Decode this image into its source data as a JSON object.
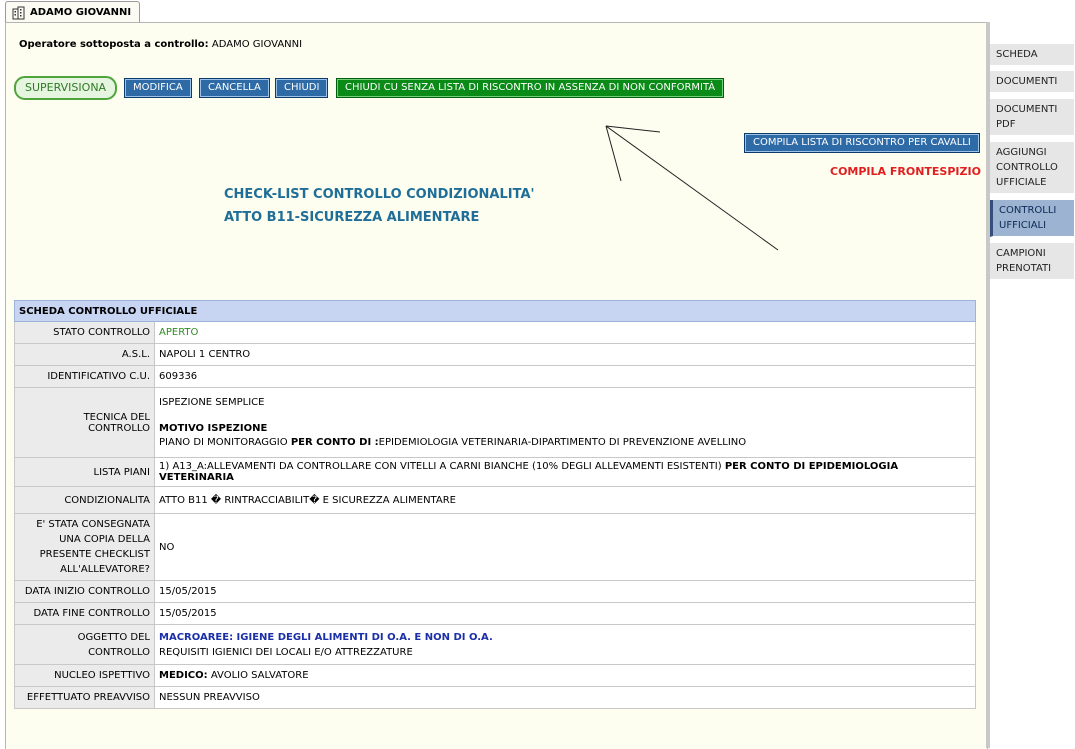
{
  "tab": {
    "icon": "building-icon",
    "label": "ADAMO GIOVANNI"
  },
  "operator": {
    "label": "Operatore sottoposta a controllo:",
    "name": "ADAMO GIOVANNI"
  },
  "buttons": {
    "supervisiona": "SUPERVISIONA",
    "modifica": "MODIFICA",
    "cancella": "CANCELLA",
    "chiudi": "CHIUDI",
    "chiudi_cu": "CHIUDI CU SENZA LISTA DI RISCONTRO IN ASSENZA DI NON CONFORMITÀ",
    "compila_lista": "COMPILA LISTA DI RISCONTRO PER CAVALLI"
  },
  "frontespizio": "COMPILA FRONTESPIZIO",
  "checklist_title": {
    "line1": "CHECK-LIST CONTROLLO CONDIZIONALITA'",
    "line2": "ATTO B11-SICUREZZA ALIMENTARE"
  },
  "table": {
    "header": "SCHEDA CONTROLLO UFFICIALE",
    "stato_label": "STATO CONTROLLO",
    "stato_value": "APERTO",
    "asl_label": "A.S.L.",
    "asl_value": "NAPOLI 1 CENTRO",
    "id_label": "IDENTIFICATIVO C.U.",
    "id_value": "609336",
    "tecnica_label": "TECNICA DEL CONTROLLO",
    "tecnica_value": "ISPEZIONE SEMPLICE",
    "motivo_label": "MOTIVO ISPEZIONE",
    "piano_prefix": "PIANO DI MONITORAGGIO",
    "piano_bold": "PER CONTO DI :",
    "piano_suffix": "EPIDEMIOLOGIA VETERINARIA-DIPARTIMENTO DI PREVENZIONE AVELLINO",
    "lista_label": "LISTA PIANI",
    "lista_value": "1) A13_A:ALLEVAMENTI DA CONTROLLARE CON VITELLI A CARNI BIANCHE (10% DEGLI ALLEVAMENTI ESISTENTI)",
    "lista_bold": "PER CONTO DI EPIDEMIOLOGIA VETERINARIA",
    "cond_label": "CONDIZIONALITA",
    "cond_value": "ATTO B11 � RINTRACCIABILIT� E SICUREZZA ALIMENTARE",
    "consegna_label": "E' STATA CONSEGNATA UNA COPIA DELLA PRESENTE CHECKLIST ALL'ALLEVATORE?",
    "consegna_value": "NO",
    "inizio_label": "DATA INIZIO CONTROLLO",
    "inizio_value": "15/05/2015",
    "fine_label": "DATA FINE CONTROLLO",
    "fine_value": "15/05/2015",
    "oggetto_label": "OGGETTO DEL CONTROLLO",
    "oggetto_macro": "MACROAREE: IGIENE DEGLI ALIMENTI DI O.A. E NON DI O.A.",
    "oggetto_req": "REQUISITI IGIENICI DEI LOCALI E/O ATTREZZATURE",
    "nucleo_label": "NUCLEO ISPETTIVO",
    "nucleo_bold": "MEDICO:",
    "nucleo_value": "AVOLIO SALVATORE",
    "preavviso_label": "EFFETTUATO PREAVVISO",
    "preavviso_value": "NESSUN PREAVVISO"
  },
  "side_menu": [
    {
      "label": "SCHEDA",
      "active": false
    },
    {
      "label": "DOCUMENTI",
      "active": false
    },
    {
      "label": "DOCUMENTI PDF",
      "active": false
    },
    {
      "label": "AGGIUNGI CONTROLLO UFFICIALE",
      "active": false
    },
    {
      "label": "CONTROLLI UFFICIALI",
      "active": true
    },
    {
      "label": "CAMPIONI PRENOTATI",
      "active": false
    }
  ],
  "colors": {
    "panel_bg": "#fdfdf0",
    "button_blue": "#2e6aa6",
    "button_green": "#0a8a16",
    "title_blue": "#1f6e98",
    "alert_red": "#e02020"
  }
}
